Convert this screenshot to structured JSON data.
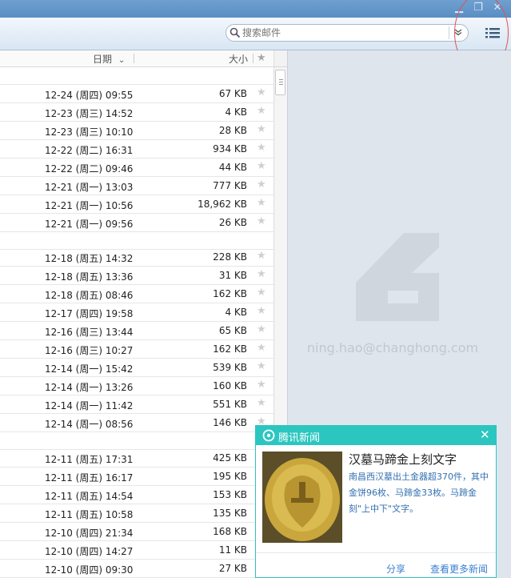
{
  "search": {
    "placeholder": "搜索邮件"
  },
  "columns": {
    "date": "日期",
    "size": "大小"
  },
  "mail_groups": [
    {
      "rows": [
        {
          "date": "12-24 (周四) 09:55",
          "size": "67 KB"
        },
        {
          "date": "12-23 (周三) 14:52",
          "size": "4 KB"
        },
        {
          "date": "12-23 (周三) 10:10",
          "size": "28 KB"
        },
        {
          "date": "12-22 (周二) 16:31",
          "size": "934 KB"
        },
        {
          "date": "12-22 (周二) 09:46",
          "size": "44 KB"
        },
        {
          "date": "12-21 (周一) 13:03",
          "size": "777 KB"
        },
        {
          "date": "12-21 (周一) 10:56",
          "size": "18,962 KB"
        },
        {
          "date": "12-21 (周一) 09:56",
          "size": "26 KB"
        }
      ]
    },
    {
      "rows": [
        {
          "date": "12-18 (周五) 14:32",
          "size": "228 KB"
        },
        {
          "date": "12-18 (周五) 13:36",
          "size": "31 KB"
        },
        {
          "date": "12-18 (周五) 08:46",
          "size": "162 KB"
        },
        {
          "date": "12-17 (周四) 19:58",
          "size": "4 KB"
        },
        {
          "date": "12-16 (周三) 13:44",
          "size": "65 KB"
        },
        {
          "date": "12-16 (周三) 10:27",
          "size": "162 KB"
        },
        {
          "date": "12-14 (周一) 15:42",
          "size": "539 KB"
        },
        {
          "date": "12-14 (周一) 13:26",
          "size": "160 KB"
        },
        {
          "date": "12-14 (周一) 11:42",
          "size": "551 KB"
        },
        {
          "date": "12-14 (周一) 08:56",
          "size": "146 KB"
        }
      ]
    },
    {
      "rows": [
        {
          "date": "12-11 (周五) 17:31",
          "size": "425 KB"
        },
        {
          "date": "12-11 (周五) 16:17",
          "size": "195 KB"
        },
        {
          "date": "12-11 (周五) 14:54",
          "size": "153 KB"
        },
        {
          "date": "12-11 (周五) 10:58",
          "size": "135 KB"
        },
        {
          "date": "12-10 (周四) 21:34",
          "size": "168 KB"
        },
        {
          "date": "12-10 (周四) 14:27",
          "size": "11 KB"
        },
        {
          "date": "12-10 (周四) 09:30",
          "size": "27 KB"
        }
      ]
    }
  ],
  "account": {
    "email": "ning.hao@changhong.com"
  },
  "news": {
    "source": "腾讯新闻",
    "headline": "汉墓马蹄金上刻文字",
    "summary": "南昌西汉墓出土金器超370件，其中金饼96枚、马蹄金33枚。马蹄金刻\"上中下\"文字。",
    "share": "分享",
    "more": "查看更多新闻"
  },
  "colors": {
    "accent": "#2cc6c0",
    "titlebar": "#5a8ec4",
    "link": "#3a7fd0"
  },
  "icons": [
    "search-icon",
    "chevron-down-icon",
    "list-view-icon",
    "star-icon",
    "tencent-news-icon",
    "close-icon"
  ]
}
